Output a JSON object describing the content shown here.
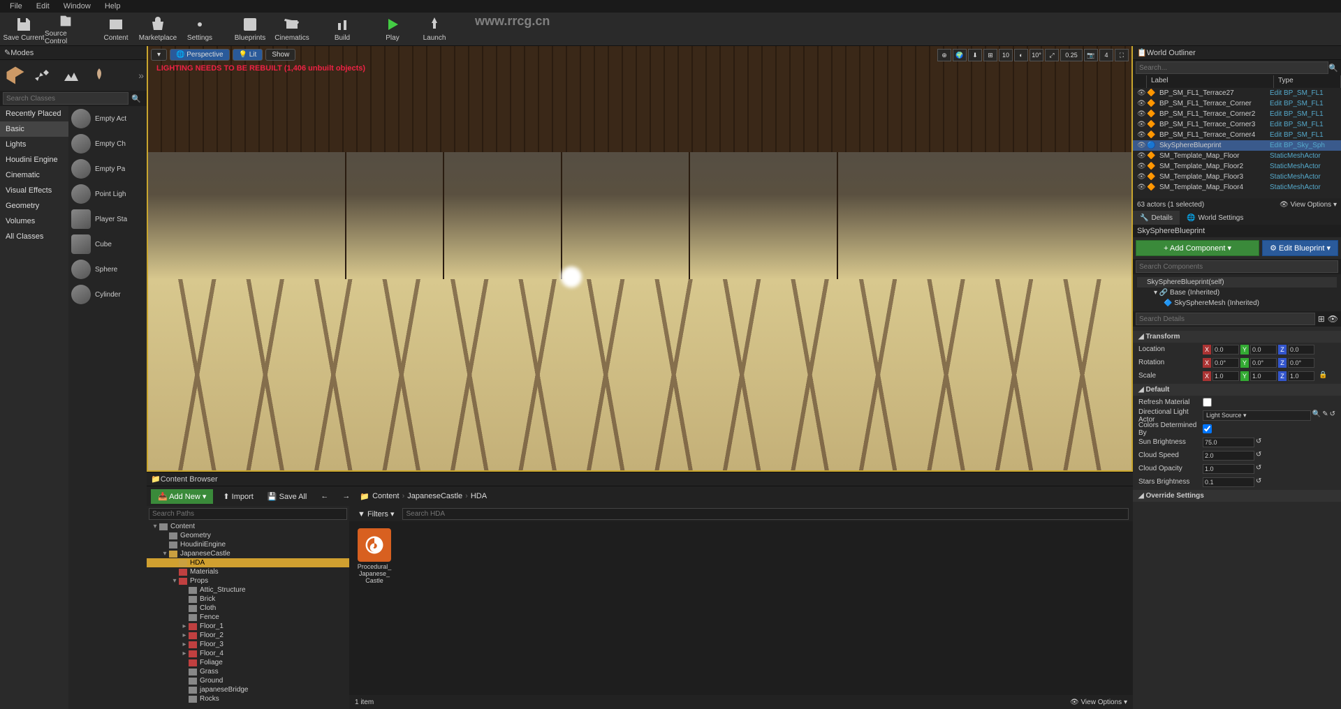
{
  "menu": [
    "File",
    "Edit",
    "Window",
    "Help"
  ],
  "toolbar": [
    {
      "label": "Save Current",
      "icon": "save"
    },
    {
      "label": "Source Control",
      "icon": "source"
    },
    {
      "label": "Content",
      "icon": "content"
    },
    {
      "label": "Marketplace",
      "icon": "market"
    },
    {
      "label": "Settings",
      "icon": "gear"
    },
    {
      "label": "Blueprints",
      "icon": "bp"
    },
    {
      "label": "Cinematics",
      "icon": "cine"
    },
    {
      "label": "Build",
      "icon": "build"
    },
    {
      "label": "Play",
      "icon": "play"
    },
    {
      "label": "Launch",
      "icon": "launch"
    }
  ],
  "modes": {
    "title": "Modes",
    "search_ph": "Search Classes"
  },
  "categories": [
    "Recently Placed",
    "Basic",
    "Lights",
    "Houdini Engine",
    "Cinematic",
    "Visual Effects",
    "Geometry",
    "Volumes",
    "All Classes"
  ],
  "placeables": [
    "Empty Act",
    "Empty Ch",
    "Empty Pa",
    "Point Ligh",
    "Player Sta",
    "Cube",
    "Sphere",
    "Cylinder"
  ],
  "viewport": {
    "persp": "Perspective",
    "lit": "Lit",
    "show": "Show",
    "warning": "LIGHTING NEEDS TO BE REBUILT (1,406 unbuilt objects)",
    "speed": "10",
    "angle": "10°",
    "snap": "0.25",
    "cam": "4"
  },
  "outliner": {
    "title": "World Outliner",
    "search_ph": "Search...",
    "col_label": "Label",
    "col_type": "Type",
    "rows": [
      {
        "name": "BP_SM_FL1_Terrace27",
        "type": "Edit BP_SM_FL1"
      },
      {
        "name": "BP_SM_FL1_Terrace_Corner",
        "type": "Edit BP_SM_FL1"
      },
      {
        "name": "BP_SM_FL1_Terrace_Corner2",
        "type": "Edit BP_SM_FL1"
      },
      {
        "name": "BP_SM_FL1_Terrace_Corner3",
        "type": "Edit BP_SM_FL1"
      },
      {
        "name": "BP_SM_FL1_Terrace_Corner4",
        "type": "Edit BP_SM_FL1"
      },
      {
        "name": "SkySphereBlueprint",
        "type": "Edit BP_Sky_Sph",
        "sel": true
      },
      {
        "name": "SM_Template_Map_Floor",
        "type": "StaticMeshActor"
      },
      {
        "name": "SM_Template_Map_Floor2",
        "type": "StaticMeshActor"
      },
      {
        "name": "SM_Template_Map_Floor3",
        "type": "StaticMeshActor"
      },
      {
        "name": "SM_Template_Map_Floor4",
        "type": "StaticMeshActor"
      }
    ],
    "status": "63 actors (1 selected)",
    "view_opt": "View Options"
  },
  "details": {
    "tab_details": "Details",
    "tab_world": "World Settings",
    "obj_name": "SkySphereBlueprint",
    "add_comp": "+ Add Component",
    "edit_bp": "⚙ Edit Blueprint",
    "search_comp": "Search Components",
    "comp_root": "SkySphereBlueprint(self)",
    "comp_base": "Base (Inherited)",
    "comp_mesh": "SkySphereMesh (Inherited)",
    "search_det": "Search Details",
    "sec_transform": "Transform",
    "sec_default": "Default",
    "sec_override": "Override Settings",
    "loc": "Location",
    "rot": "Rotation",
    "scl": "Scale",
    "loc_v": [
      "0.0",
      "0.0",
      "0.0"
    ],
    "rot_v": [
      "0.0°",
      "0.0°",
      "0.0°"
    ],
    "scl_v": [
      "1.0",
      "1.0",
      "1.0"
    ],
    "refresh_mat": "Refresh Material",
    "dir_light": "Directional Light Actor",
    "dir_light_v": "Light Source",
    "colors_det": "Colors Determined By",
    "sun_bright": "Sun Brightness",
    "sun_bright_v": "75.0",
    "cloud_speed": "Cloud Speed",
    "cloud_speed_v": "2.0",
    "cloud_opac": "Cloud Opacity",
    "cloud_opac_v": "1.0",
    "stars_bright": "Stars Brightness",
    "stars_bright_v": "0.1"
  },
  "cb": {
    "title": "Content Browser",
    "addnew": "Add New",
    "import": "Import",
    "saveall": "Save All",
    "path": [
      "Content",
      "JapaneseCastle",
      "HDA"
    ],
    "search_paths": "Search Paths",
    "filters": "Filters",
    "search_hda": "Search HDA",
    "tree": [
      {
        "l": "Content",
        "d": 0,
        "open": true,
        "cls": "grey"
      },
      {
        "l": "Geometry",
        "d": 1,
        "cls": "grey"
      },
      {
        "l": "HoudiniEngine",
        "d": 1,
        "cls": "grey"
      },
      {
        "l": "JapaneseCastle",
        "d": 1,
        "open": true,
        "cls": ""
      },
      {
        "l": "HDA",
        "d": 2,
        "sel": true,
        "cls": ""
      },
      {
        "l": "Materials",
        "d": 2,
        "cls": "red"
      },
      {
        "l": "Props",
        "d": 2,
        "open": true,
        "cls": "red"
      },
      {
        "l": "Attic_Structure",
        "d": 3,
        "cls": "grey"
      },
      {
        "l": "Brick",
        "d": 3,
        "cls": "grey"
      },
      {
        "l": "Cloth",
        "d": 3,
        "cls": "grey"
      },
      {
        "l": "Fence",
        "d": 3,
        "cls": "grey"
      },
      {
        "l": "Floor_1",
        "d": 3,
        "cls": "red",
        "ar": true
      },
      {
        "l": "Floor_2",
        "d": 3,
        "cls": "red",
        "ar": true
      },
      {
        "l": "Floor_3",
        "d": 3,
        "cls": "red",
        "ar": true
      },
      {
        "l": "Floor_4",
        "d": 3,
        "cls": "red",
        "ar": true
      },
      {
        "l": "Foliage",
        "d": 3,
        "cls": "red"
      },
      {
        "l": "Grass",
        "d": 3,
        "cls": "grey"
      },
      {
        "l": "Ground",
        "d": 3,
        "cls": "grey"
      },
      {
        "l": "japaneseBridge",
        "d": 3,
        "cls": "grey"
      },
      {
        "l": "Rocks",
        "d": 3,
        "cls": "grey"
      }
    ],
    "asset_name": "Procedural_\nJapanese_\nCastle",
    "item_count": "1 item",
    "view_opt": "View Options"
  },
  "watermark_url": "www.rrcg.cn"
}
